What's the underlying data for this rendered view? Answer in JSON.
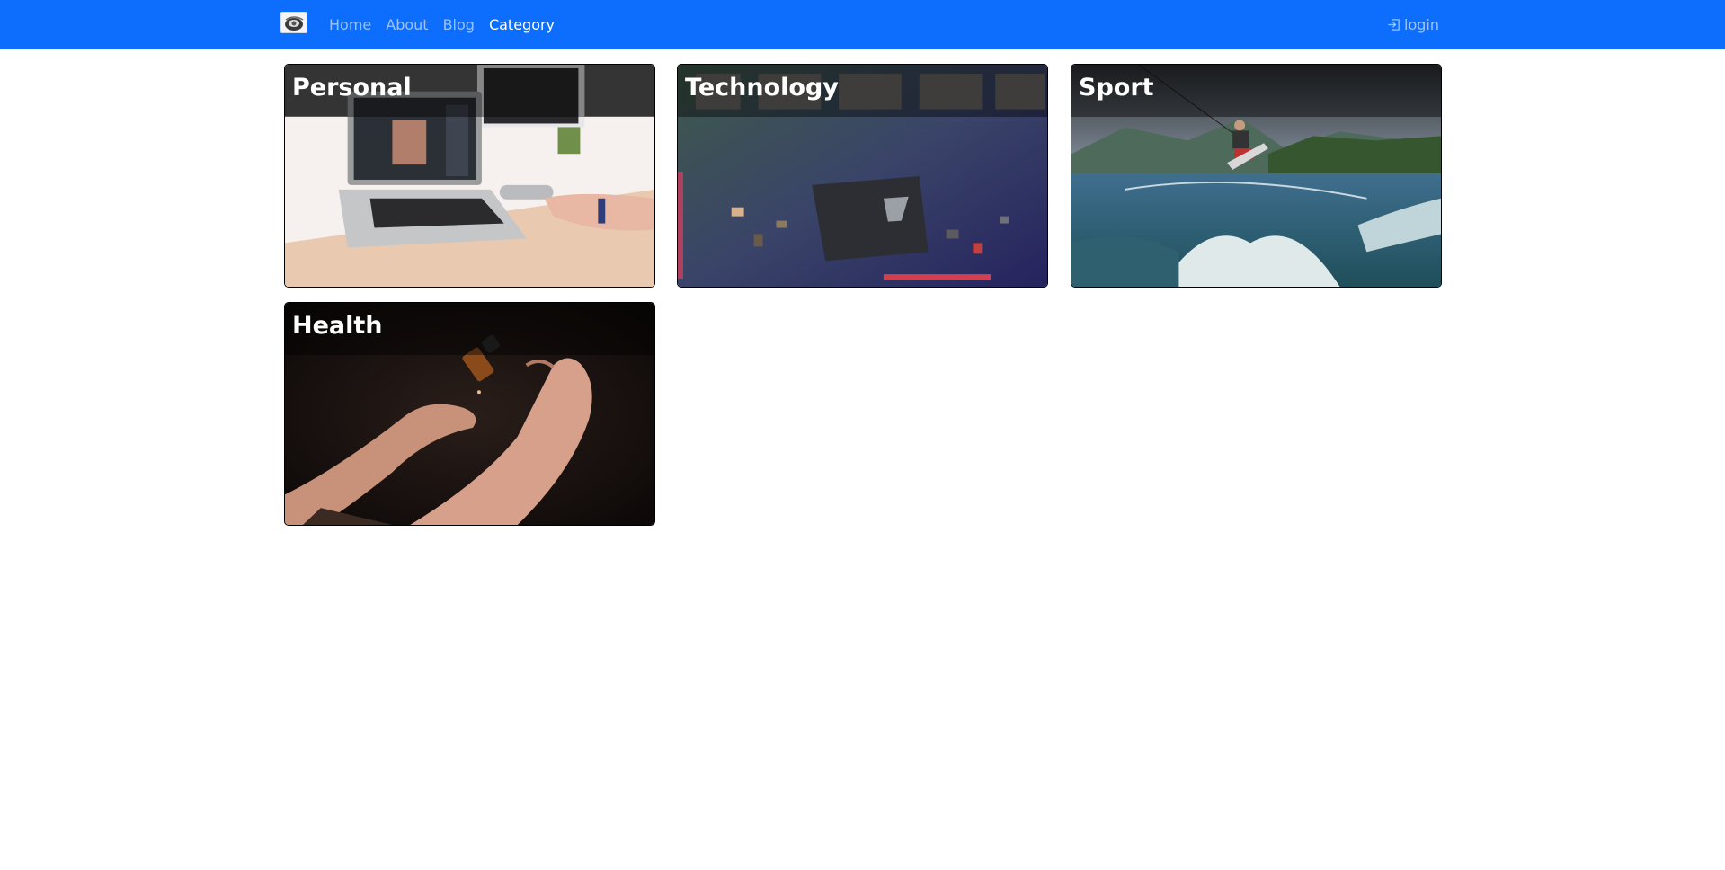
{
  "navbar": {
    "brand_icon": "site-logo-icon",
    "color": "#0d6efd",
    "links": [
      {
        "label": "Home",
        "active": false
      },
      {
        "label": "About",
        "active": false
      },
      {
        "label": "Blog",
        "active": false
      },
      {
        "label": "Category",
        "active": true
      }
    ],
    "login": {
      "icon": "login-icon",
      "label": "login"
    }
  },
  "categories": [
    {
      "title": "Personal",
      "image": "laptop-desk-photo"
    },
    {
      "title": "Technology",
      "image": "circuit-board-photo"
    },
    {
      "title": "Sport",
      "image": "wakeboarding-photo"
    },
    {
      "title": "Health",
      "image": "oil-dropper-hands-photo"
    }
  ]
}
